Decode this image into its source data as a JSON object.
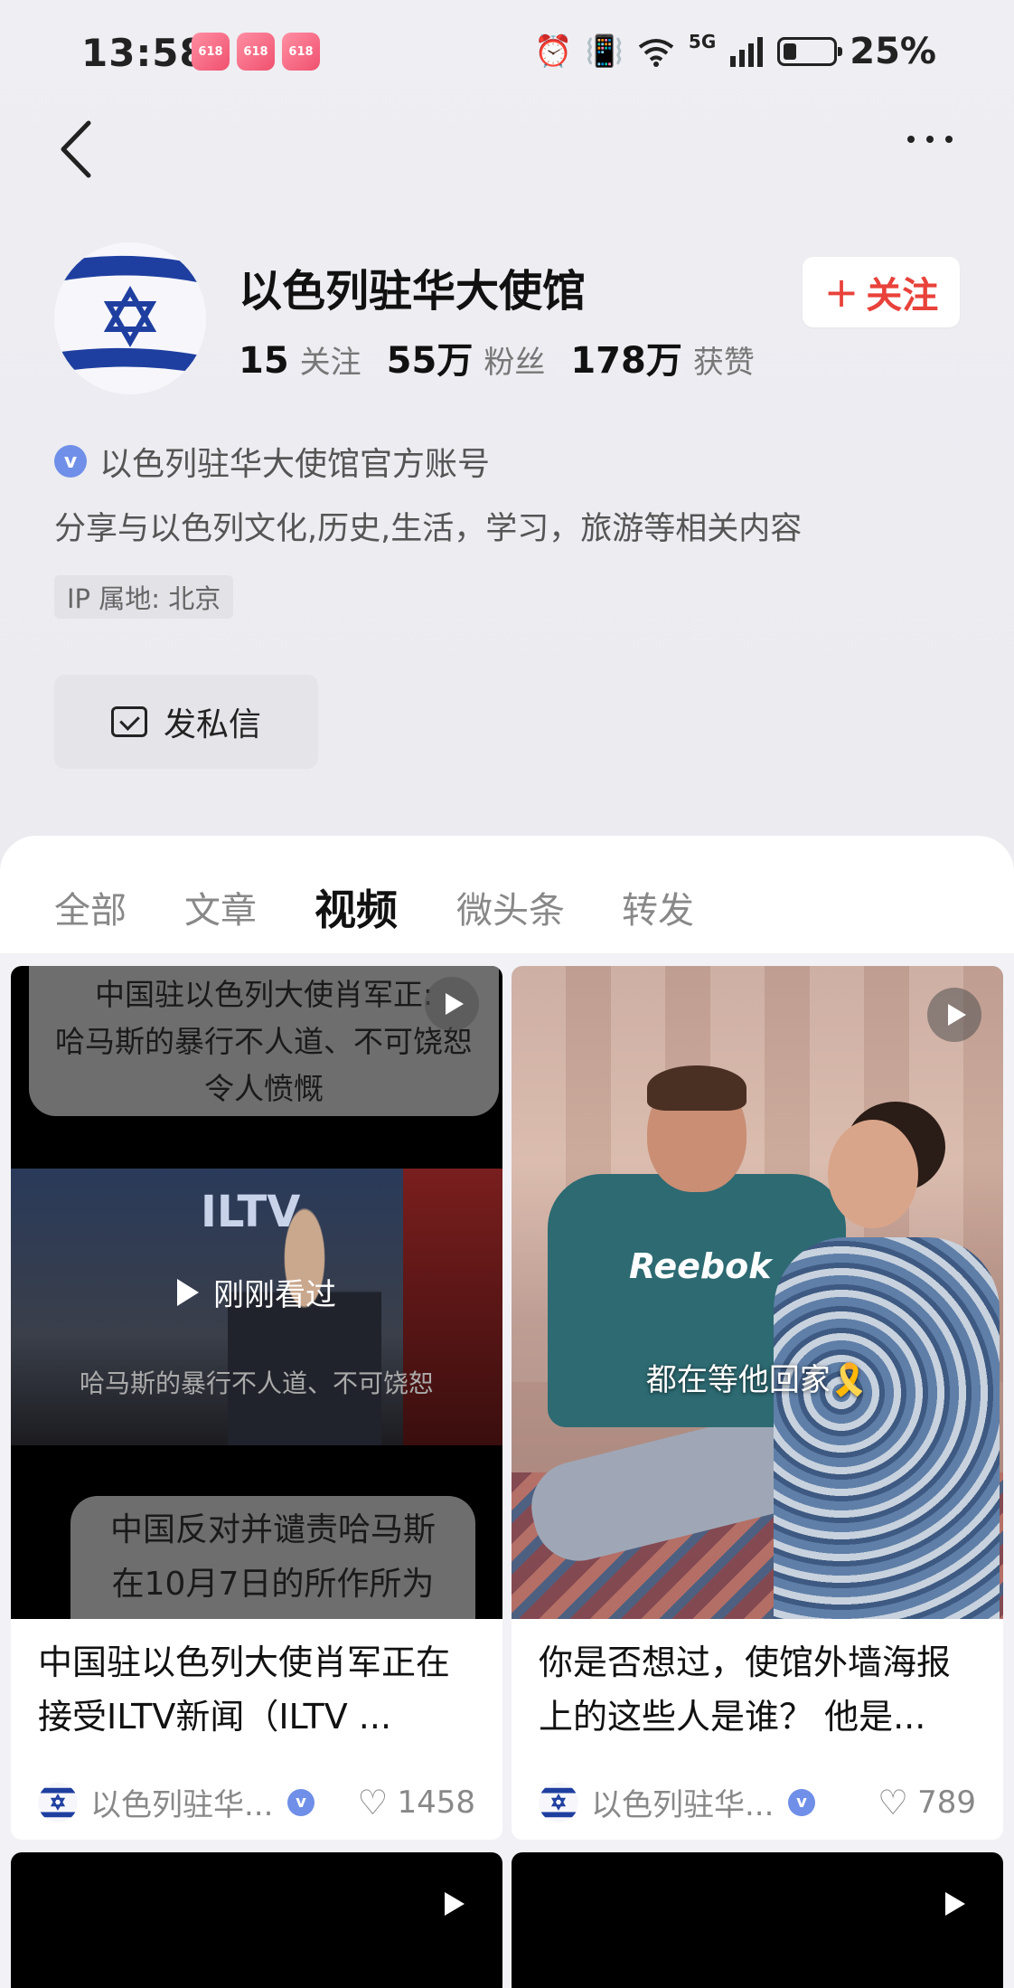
{
  "status_bar": {
    "time": "13:58",
    "badges": [
      "618",
      "618",
      "618"
    ],
    "network": "5G",
    "battery": "25%"
  },
  "profile": {
    "name": "以色列驻华大使馆",
    "stats": [
      {
        "num": "15",
        "label": "关注"
      },
      {
        "num": "55万",
        "label": "粉丝"
      },
      {
        "num": "178万",
        "label": "获赞"
      }
    ],
    "follow_label": "关注",
    "verified_text": "以色列驻华大使馆官方账号",
    "bio": "分享与以色列文化,历史,生活，学习，旅游等相关内容",
    "ip": "IP 属地: 北京",
    "message_label": "发私信"
  },
  "tabs": [
    {
      "label": "全部",
      "active": false
    },
    {
      "label": "文章",
      "active": false
    },
    {
      "label": "视频",
      "active": true
    },
    {
      "label": "微头条",
      "active": false
    },
    {
      "label": "转发",
      "active": false
    }
  ],
  "videos": [
    {
      "thumb_top_text_1": "中国驻以色列大使肖军正:",
      "thumb_top_text_2": "哈马斯的暴行不人道、不可饶恕",
      "thumb_top_text_3": "令人愤慨",
      "thumb_logo": "ILTV",
      "watched_label": "刚刚看过",
      "thumb_sub": "哈马斯的暴行不人道、不可饶恕",
      "thumb_bottom_text_1": "中国反对并谴责哈马斯",
      "thumb_bottom_text_2": "在10月7日的所作所为",
      "title": "中国驻以色列大使肖军正在接受ILTV新闻（ILTV ...",
      "author": "以色列驻华...",
      "likes": "1458"
    },
    {
      "thumb_brand": "Reebok",
      "thumb_overlay": "都在等他回家🎗️",
      "title": "你是否想过，使馆外墙海报上的这些人是谁？ 他是...",
      "author": "以色列驻华...",
      "likes": "789"
    }
  ],
  "icons": {
    "back": "back-arrow-icon",
    "more": "more-dots-icon",
    "verified": "v",
    "mail": "mail-icon",
    "heart": "♡",
    "play": "play-icon"
  },
  "colors": {
    "accent": "#e8423a",
    "verified": "#6f8fe8",
    "flag_blue": "#1f3fa0"
  }
}
